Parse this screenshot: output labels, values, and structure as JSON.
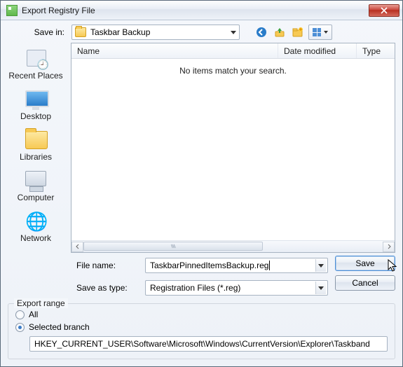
{
  "window": {
    "title": "Export Registry File"
  },
  "toolbar": {
    "save_in_label": "Save in:",
    "save_in_value": "Taskbar Backup"
  },
  "places": [
    {
      "label": "Recent Places",
      "icon": "recent"
    },
    {
      "label": "Desktop",
      "icon": "desktop"
    },
    {
      "label": "Libraries",
      "icon": "libraries"
    },
    {
      "label": "Computer",
      "icon": "computer"
    },
    {
      "label": "Network",
      "icon": "network"
    }
  ],
  "list": {
    "columns": {
      "name": "Name",
      "date": "Date modified",
      "type": "Type"
    },
    "empty_message": "No items match your search."
  },
  "form": {
    "filename_label": "File name:",
    "filename_value": "TaskbarPinnedItemsBackup.reg",
    "saveas_label": "Save as type:",
    "saveas_value": "Registration Files (*.reg)",
    "save_button": "Save",
    "cancel_button": "Cancel"
  },
  "export_range": {
    "legend": "Export range",
    "all_label": "All",
    "selected_label": "Selected branch",
    "selected": "selected",
    "branch_path": "HKEY_CURRENT_USER\\Software\\Microsoft\\Windows\\CurrentVersion\\Explorer\\Taskband"
  }
}
